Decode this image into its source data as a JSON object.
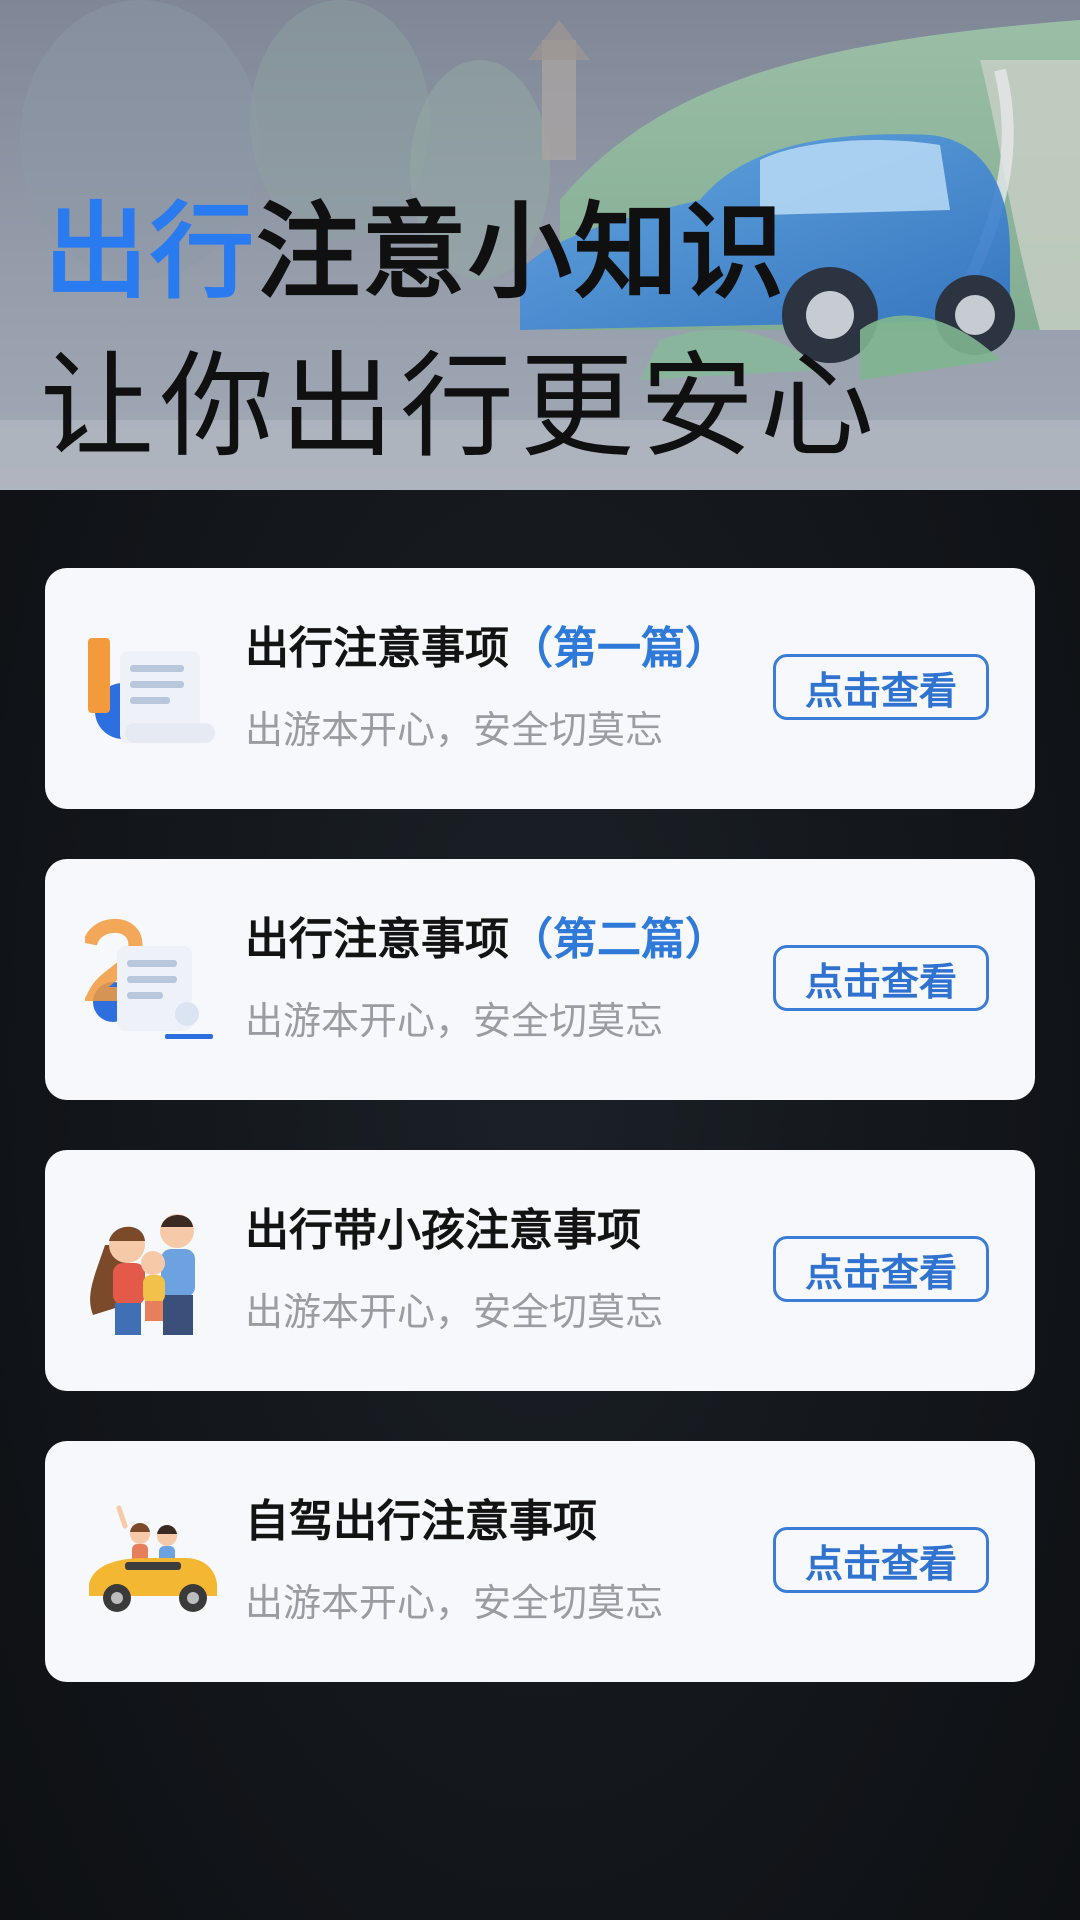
{
  "hero": {
    "title_accent": "出行",
    "title_rest": "注意小知识",
    "subtitle": "让你出行更安心"
  },
  "colors": {
    "accent": "#2b7bf0",
    "button_border": "#3b7dd6",
    "card_bg": "#f7f8fb",
    "page_bg": "#111418"
  },
  "cards": [
    {
      "icon": "document-number-1-icon",
      "title": "出行注意事项",
      "title_part": "（第一篇）",
      "subtitle": "出游本开心，安全切莫忘",
      "button": "点击查看"
    },
    {
      "icon": "document-number-2-icon",
      "title": "出行注意事项",
      "title_part": "（第二篇）",
      "subtitle": "出游本开心，安全切莫忘",
      "button": "点击查看"
    },
    {
      "icon": "family-icon",
      "title": "出行带小孩注意事项",
      "title_part": "",
      "subtitle": "出游本开心，安全切莫忘",
      "button": "点击查看"
    },
    {
      "icon": "convertible-car-icon",
      "title": "自驾出行注意事项",
      "title_part": "",
      "subtitle": "出游本开心，安全切莫忘",
      "button": "点击查看"
    }
  ]
}
